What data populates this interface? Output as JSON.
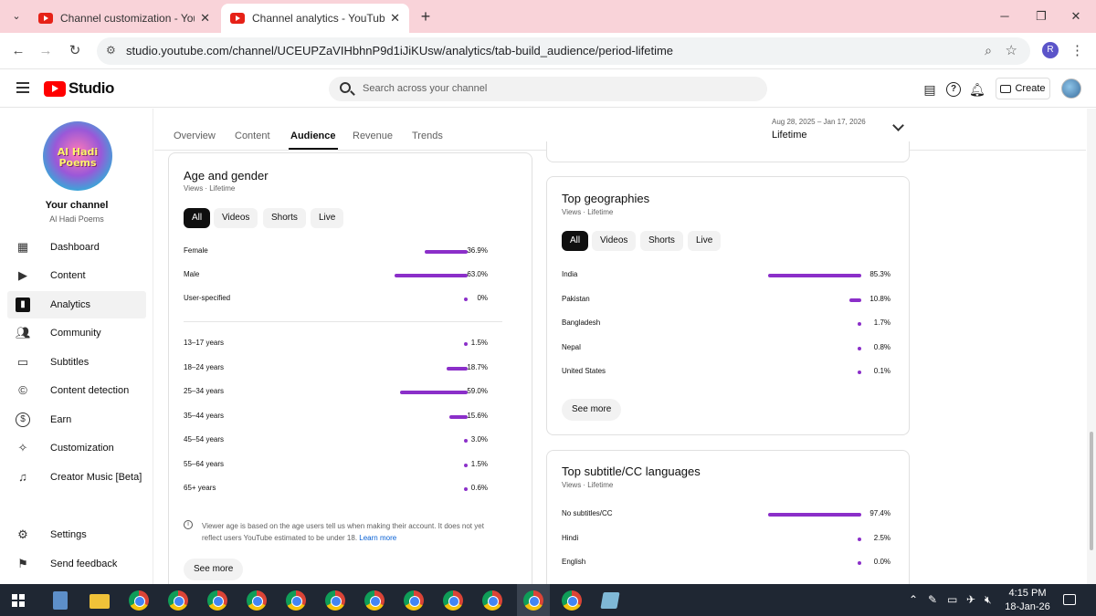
{
  "browser": {
    "tabs": [
      {
        "title": "Channel customization - YouTu"
      },
      {
        "title": "Channel analytics - YouTube St"
      }
    ],
    "url": "studio.youtube.com/channel/UCEUPZaVIHbhnP9d1iJiKUsw/analytics/tab-build_audience/period-lifetime",
    "profile_initial": "R"
  },
  "header": {
    "logo_text": "Studio",
    "search_placeholder": "Search across your channel",
    "create_label": "Create"
  },
  "sidebar": {
    "channel_logo_text": "Al Hadi Poems",
    "your_channel": "Your channel",
    "channel_name": "Al Hadi Poems",
    "items": [
      {
        "label": "Dashboard",
        "icon": "dashboard-icon"
      },
      {
        "label": "Content",
        "icon": "content-icon"
      },
      {
        "label": "Analytics",
        "icon": "analytics-icon",
        "active": true
      },
      {
        "label": "Community",
        "icon": "community-icon"
      },
      {
        "label": "Subtitles",
        "icon": "subtitles-icon"
      },
      {
        "label": "Content detection",
        "icon": "copyright-icon"
      },
      {
        "label": "Earn",
        "icon": "dollar-icon"
      },
      {
        "label": "Customization",
        "icon": "magic-wand-icon"
      },
      {
        "label": "Creator Music [Beta]",
        "icon": "music-icon"
      }
    ],
    "footer": [
      {
        "label": "Settings",
        "icon": "gear-icon"
      },
      {
        "label": "Send feedback",
        "icon": "feedback-icon"
      }
    ]
  },
  "main": {
    "tabs": [
      "Overview",
      "Content",
      "Audience",
      "Revenue",
      "Trends"
    ],
    "active_tab": "Audience",
    "period": {
      "range": "Aug 28, 2025 – Jan 17, 2026",
      "label": "Lifetime"
    },
    "chips": [
      "All",
      "Videos",
      "Shorts",
      "Live"
    ],
    "age_gender": {
      "title": "Age and gender",
      "subtitle": "Views · Lifetime",
      "gender": [
        {
          "label": "Female",
          "pct": "36.9%",
          "value": 36.9
        },
        {
          "label": "Male",
          "pct": "63.0%",
          "value": 63.0
        },
        {
          "label": "User-specified",
          "pct": "0%",
          "value": 0
        }
      ],
      "ages": [
        {
          "label": "13–17 years",
          "pct": "1.5%",
          "value": 1.5
        },
        {
          "label": "18–24 years",
          "pct": "18.7%",
          "value": 18.7
        },
        {
          "label": "25–34 years",
          "pct": "59.0%",
          "value": 59.0
        },
        {
          "label": "35–44 years",
          "pct": "15.6%",
          "value": 15.6
        },
        {
          "label": "45–54 years",
          "pct": "3.0%",
          "value": 3.0
        },
        {
          "label": "55–64 years",
          "pct": "1.5%",
          "value": 1.5
        },
        {
          "label": "65+ years",
          "pct": "0.6%",
          "value": 0.6
        }
      ],
      "note": "Viewer age is based on the age users tell us when making their account. It does not yet reflect users YouTube estimated to be under 18.",
      "learn_more": "Learn more",
      "see_more": "See more"
    },
    "geographies": {
      "title": "Top geographies",
      "subtitle": "Views · Lifetime",
      "rows": [
        {
          "label": "India",
          "pct": "85.3%",
          "value": 85.3
        },
        {
          "label": "Pakistan",
          "pct": "10.8%",
          "value": 10.8
        },
        {
          "label": "Bangladesh",
          "pct": "1.7%",
          "value": 1.7
        },
        {
          "label": "Nepal",
          "pct": "0.8%",
          "value": 0.8
        },
        {
          "label": "United States",
          "pct": "0.1%",
          "value": 0.1
        }
      ],
      "see_more": "See more"
    },
    "subtitles": {
      "title": "Top subtitle/CC languages",
      "subtitle": "Views · Lifetime",
      "rows": [
        {
          "label": "No subtitles/CC",
          "pct": "97.4%",
          "value": 97.4
        },
        {
          "label": "Hindi",
          "pct": "2.5%",
          "value": 2.5
        },
        {
          "label": "English",
          "pct": "0.0%",
          "value": 0.0
        }
      ]
    }
  },
  "taskbar": {
    "time": "4:15 PM",
    "date": "18-Jan-26"
  },
  "colors": {
    "bar": "#8b2fc9",
    "tabstrip": "#f9d3d9",
    "youtube_red": "#ff0000",
    "link": "#065fd4"
  }
}
